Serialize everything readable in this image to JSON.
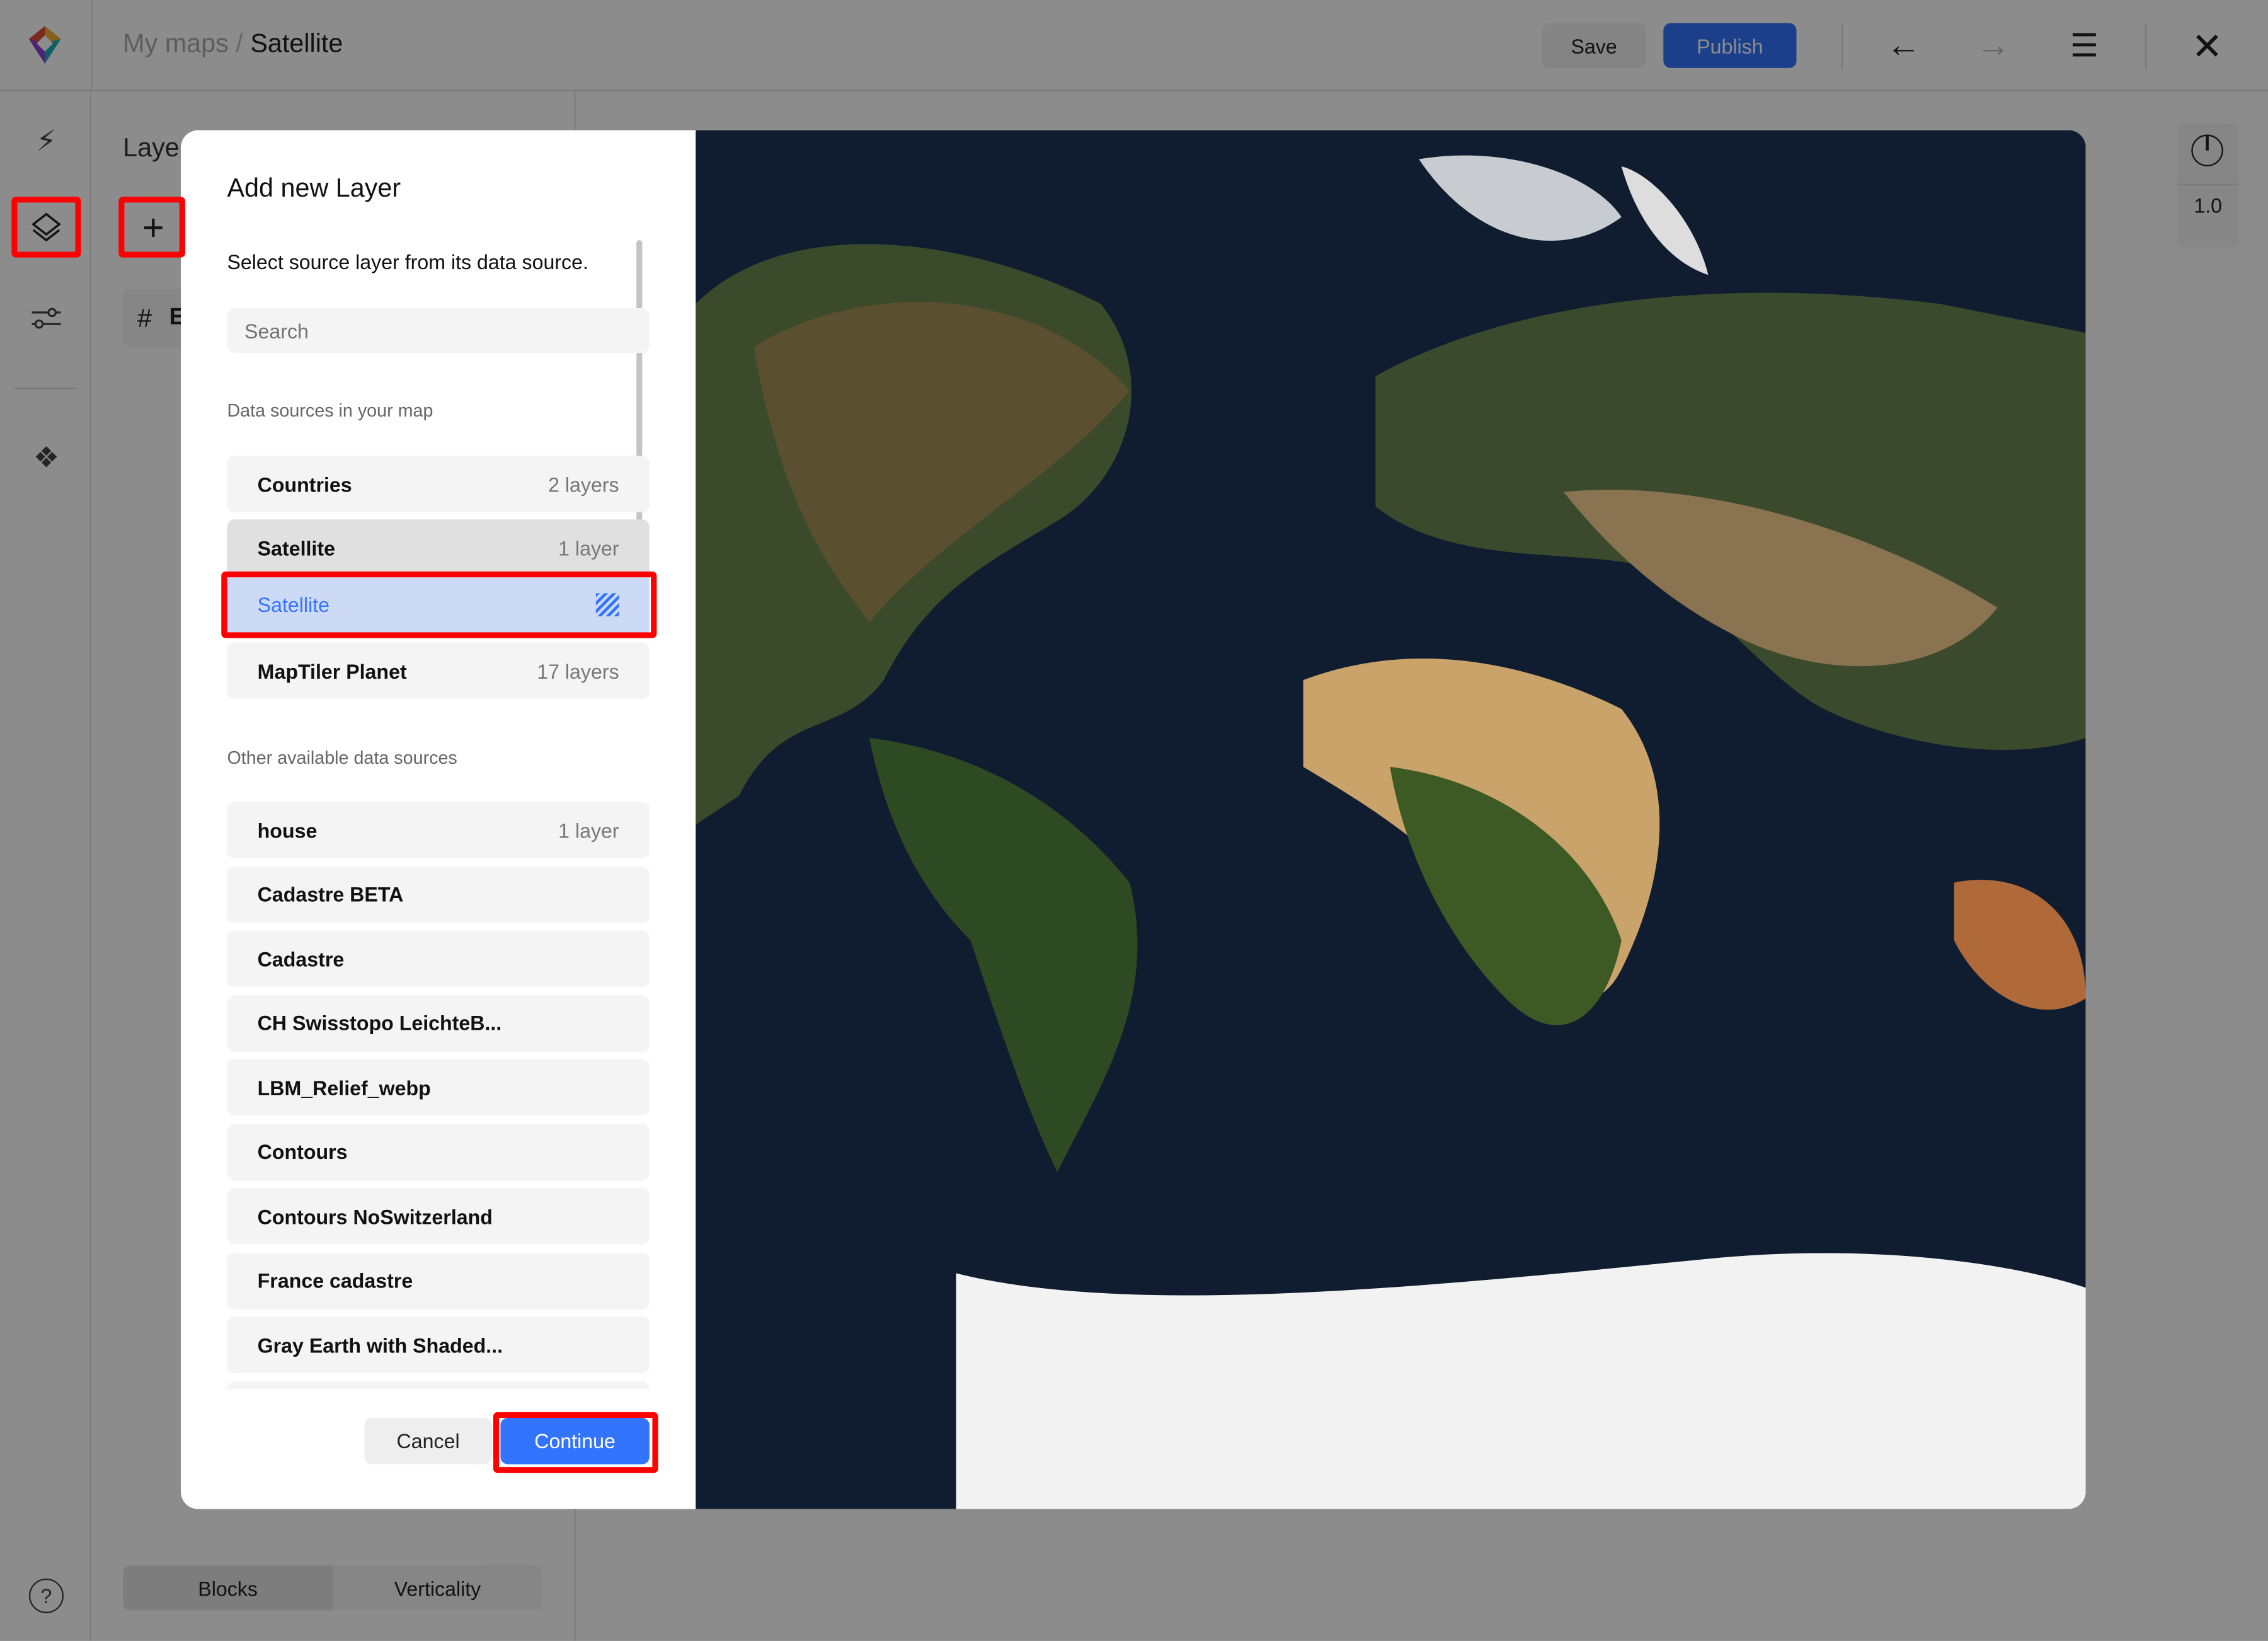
{
  "header": {
    "breadcrumb_parent": "My maps",
    "breadcrumb_sep": "/",
    "breadcrumb_current": "Satellite",
    "save_label": "Save",
    "publish_label": "Publish"
  },
  "panel": {
    "title": "Layers",
    "row_label": "E",
    "tabs": [
      {
        "label": "Blocks"
      },
      {
        "label": "Verticality"
      }
    ]
  },
  "map_controls": {
    "zoom_value": "1.0"
  },
  "modal": {
    "title": "Add new Layer",
    "subtitle": "Select source layer from its data source.",
    "search_placeholder": "Search",
    "section_map": "Data sources in your map",
    "map_sources": [
      {
        "name": "Countries",
        "count": "2 layers"
      },
      {
        "name": "Satellite",
        "count": "1 layer"
      }
    ],
    "selected_layer": {
      "name": "Satellite",
      "icon": "raster-hatch-icon"
    },
    "map_sources_more": [
      {
        "name": "MapTiler Planet",
        "count": "17 layers"
      }
    ],
    "section_other": "Other available data sources",
    "other_sources": [
      {
        "name": "house",
        "count": "1 layer"
      },
      {
        "name": "Cadastre BETA",
        "count": ""
      },
      {
        "name": "Cadastre",
        "count": ""
      },
      {
        "name": "CH Swisstopo LeichteB...",
        "count": ""
      },
      {
        "name": "LBM_Relief_webp",
        "count": ""
      },
      {
        "name": "Contours",
        "count": ""
      },
      {
        "name": "Contours NoSwitzerland",
        "count": ""
      },
      {
        "name": "France cadastre",
        "count": ""
      },
      {
        "name": "Gray Earth with Shaded...",
        "count": ""
      }
    ],
    "cancel_label": "Cancel",
    "continue_label": "Continue"
  },
  "colors": {
    "accent": "#3374ff",
    "highlight": "#ff0000",
    "selected_bg": "#cddaf5"
  }
}
